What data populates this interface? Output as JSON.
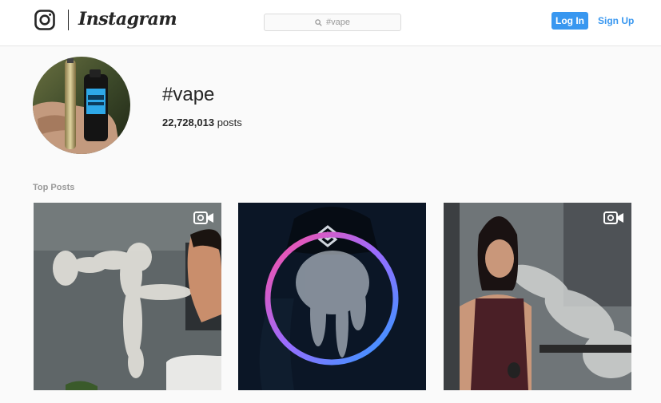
{
  "header": {
    "brand": "Instagram",
    "search_value": "#vape",
    "login_label": "Log In",
    "signup_label": "Sign Up"
  },
  "profile": {
    "hashtag": "#vape",
    "post_count": "22,728,013",
    "post_count_suffix": "posts"
  },
  "top_posts": {
    "label": "Top Posts",
    "items": [
      {
        "type": "video",
        "icon": "video-icon"
      },
      {
        "type": "image"
      },
      {
        "type": "video",
        "icon": "video-icon"
      }
    ]
  },
  "colors": {
    "accent": "#3897f0",
    "text": "#262626",
    "muted": "#999999",
    "background": "#fafafa"
  }
}
